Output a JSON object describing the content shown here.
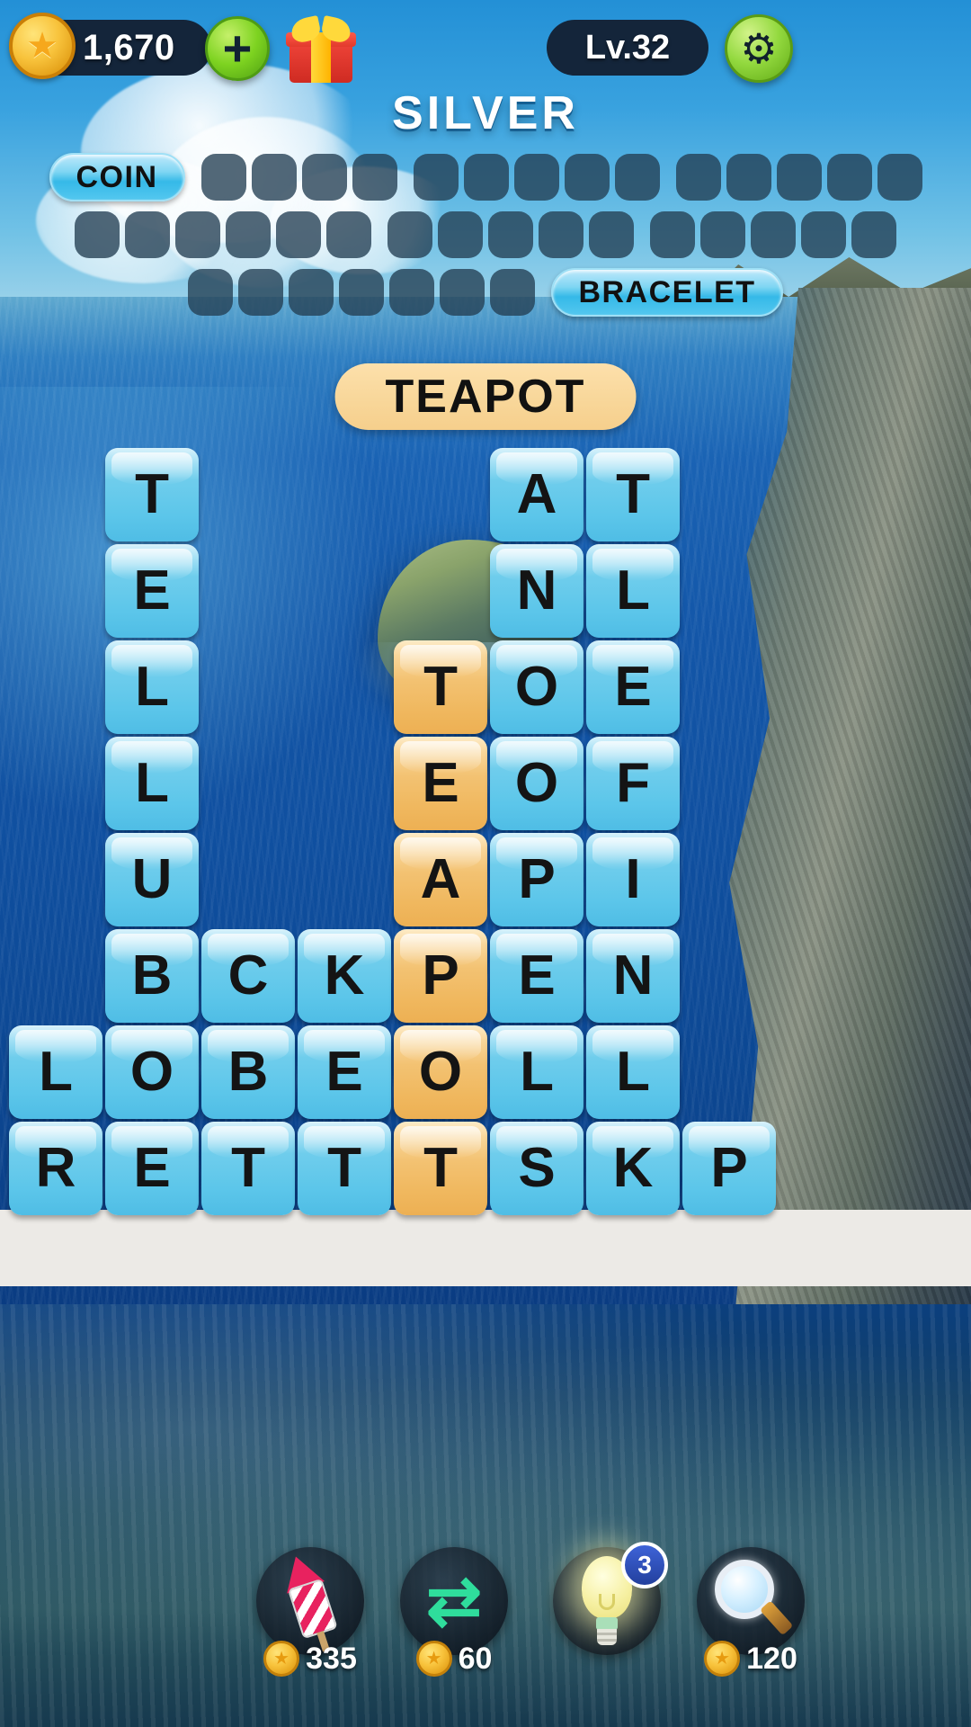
{
  "hud": {
    "coins": "1,670",
    "coin_icon": "coin-star-icon",
    "add_label": "+",
    "gift_icon": "gift-box-icon",
    "level": "Lv.32",
    "settings_icon": "gear-icon"
  },
  "title": "SILVER",
  "wordlist": {
    "rows": [
      {
        "items": [
          {
            "type": "found",
            "text": "COIN"
          },
          {
            "type": "slots",
            "count": 4
          },
          {
            "type": "slots",
            "count": 5
          },
          {
            "type": "slots",
            "count": 5
          }
        ]
      },
      {
        "items": [
          {
            "type": "slots",
            "count": 6
          },
          {
            "type": "slots",
            "count": 5
          },
          {
            "type": "slots",
            "count": 5
          }
        ]
      },
      {
        "items": [
          {
            "type": "slots",
            "count": 7
          },
          {
            "type": "found",
            "text": "BRACELET"
          }
        ]
      }
    ]
  },
  "current_word": "TEAPOT",
  "grid": {
    "columns": 8,
    "rows": 8,
    "cells": [
      {
        "col": 1,
        "row": 0,
        "letter": "T",
        "state": "blue"
      },
      {
        "col": 1,
        "row": 1,
        "letter": "E",
        "state": "blue"
      },
      {
        "col": 1,
        "row": 2,
        "letter": "L",
        "state": "blue"
      },
      {
        "col": 1,
        "row": 3,
        "letter": "L",
        "state": "blue"
      },
      {
        "col": 1,
        "row": 4,
        "letter": "U",
        "state": "blue"
      },
      {
        "col": 1,
        "row": 5,
        "letter": "B",
        "state": "blue"
      },
      {
        "col": 2,
        "row": 5,
        "letter": "C",
        "state": "blue"
      },
      {
        "col": 3,
        "row": 5,
        "letter": "K",
        "state": "blue"
      },
      {
        "col": 0,
        "row": 6,
        "letter": "L",
        "state": "blue"
      },
      {
        "col": 1,
        "row": 6,
        "letter": "O",
        "state": "blue"
      },
      {
        "col": 2,
        "row": 6,
        "letter": "B",
        "state": "blue"
      },
      {
        "col": 3,
        "row": 6,
        "letter": "E",
        "state": "blue"
      },
      {
        "col": 0,
        "row": 7,
        "letter": "R",
        "state": "blue"
      },
      {
        "col": 1,
        "row": 7,
        "letter": "E",
        "state": "blue"
      },
      {
        "col": 2,
        "row": 7,
        "letter": "T",
        "state": "blue"
      },
      {
        "col": 3,
        "row": 7,
        "letter": "T",
        "state": "blue"
      },
      {
        "col": 4,
        "row": 2,
        "letter": "T",
        "state": "gold"
      },
      {
        "col": 4,
        "row": 3,
        "letter": "E",
        "state": "gold"
      },
      {
        "col": 4,
        "row": 4,
        "letter": "A",
        "state": "gold"
      },
      {
        "col": 4,
        "row": 5,
        "letter": "P",
        "state": "gold"
      },
      {
        "col": 4,
        "row": 6,
        "letter": "O",
        "state": "gold"
      },
      {
        "col": 4,
        "row": 7,
        "letter": "T",
        "state": "gold"
      },
      {
        "col": 5,
        "row": 0,
        "letter": "A",
        "state": "blue"
      },
      {
        "col": 5,
        "row": 1,
        "letter": "N",
        "state": "blue"
      },
      {
        "col": 5,
        "row": 2,
        "letter": "O",
        "state": "blue"
      },
      {
        "col": 5,
        "row": 3,
        "letter": "O",
        "state": "blue"
      },
      {
        "col": 5,
        "row": 4,
        "letter": "P",
        "state": "blue"
      },
      {
        "col": 5,
        "row": 5,
        "letter": "E",
        "state": "blue"
      },
      {
        "col": 5,
        "row": 6,
        "letter": "L",
        "state": "blue"
      },
      {
        "col": 5,
        "row": 7,
        "letter": "S",
        "state": "blue"
      },
      {
        "col": 6,
        "row": 0,
        "letter": "T",
        "state": "blue"
      },
      {
        "col": 6,
        "row": 1,
        "letter": "L",
        "state": "blue"
      },
      {
        "col": 6,
        "row": 2,
        "letter": "E",
        "state": "blue"
      },
      {
        "col": 6,
        "row": 3,
        "letter": "F",
        "state": "blue"
      },
      {
        "col": 6,
        "row": 4,
        "letter": "I",
        "state": "blue"
      },
      {
        "col": 6,
        "row": 5,
        "letter": "N",
        "state": "blue"
      },
      {
        "col": 6,
        "row": 6,
        "letter": "L",
        "state": "blue"
      },
      {
        "col": 6,
        "row": 7,
        "letter": "K",
        "state": "blue"
      },
      {
        "col": 7,
        "row": 7,
        "letter": "P",
        "state": "blue"
      }
    ]
  },
  "powerups": [
    {
      "name": "rocket",
      "icon": "rocket-icon",
      "cost": "335",
      "badge": null
    },
    {
      "name": "shuffle",
      "icon": "shuffle-icon",
      "cost": "60",
      "badge": null
    },
    {
      "name": "hint",
      "icon": "lightbulb-icon",
      "cost": null,
      "badge": "3"
    },
    {
      "name": "search",
      "icon": "magnifier-icon",
      "cost": "120",
      "badge": null
    }
  ],
  "colors": {
    "tile_blue": "#5cc6ea",
    "tile_gold": "#f3c272",
    "hud_dark": "#14253a",
    "accent_green": "#7ed321",
    "chip_blue": "#35b9e8",
    "current_word_bg": "#f8d79a"
  }
}
